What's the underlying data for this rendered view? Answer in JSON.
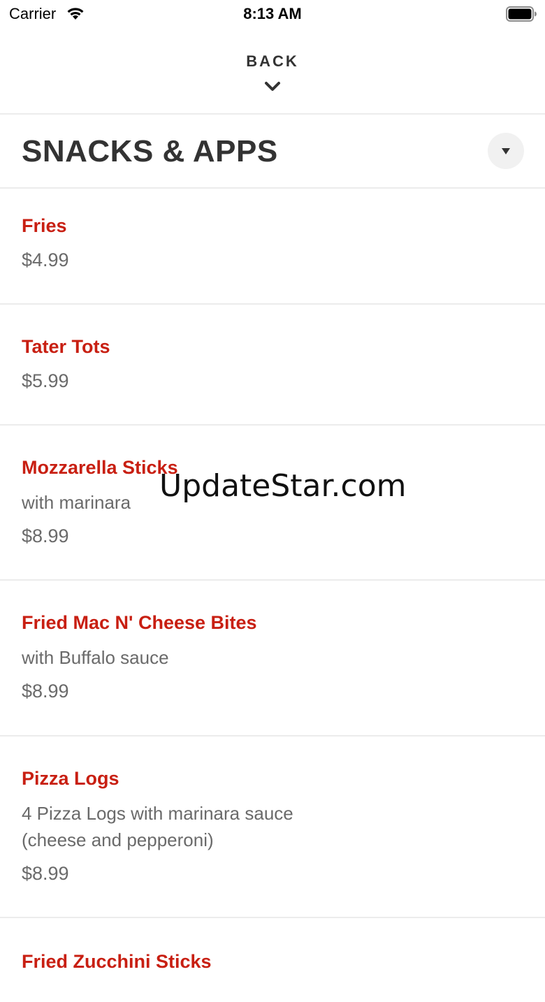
{
  "status_bar": {
    "carrier": "Carrier",
    "time": "8:13 AM"
  },
  "nav": {
    "back_label": "BACK"
  },
  "section": {
    "title": "SNACKS & APPS"
  },
  "items": [
    {
      "name": "Fries",
      "description": "",
      "price": "$4.99"
    },
    {
      "name": "Tater Tots",
      "description": "",
      "price": "$5.99"
    },
    {
      "name": "Mozzarella Sticks",
      "description": "with marinara",
      "price": "$8.99"
    },
    {
      "name": "Fried Mac N' Cheese Bites",
      "description": "with Buffalo sauce",
      "price": "$8.99"
    },
    {
      "name": "Pizza Logs",
      "description_lines": [
        "4 Pizza Logs with marinara sauce",
        "(cheese and pepperoni)"
      ],
      "price": "$8.99"
    },
    {
      "name": "Fried Zucchini Sticks",
      "description": "",
      "price": ""
    }
  ],
  "watermark": "UpdateStar.com",
  "colors": {
    "item_name": "#c81f12",
    "secondary_text": "#6a6a6a",
    "title_text": "#333333",
    "divider": "#ececec"
  }
}
